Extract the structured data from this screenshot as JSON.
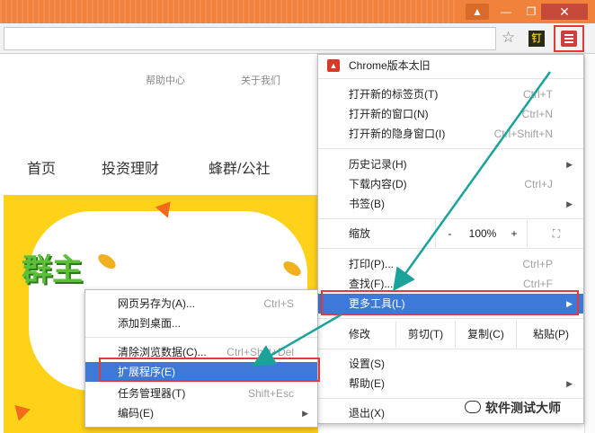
{
  "window": {
    "controls": {
      "user": "▲",
      "minimize": "—",
      "maximize": "❐",
      "close": "✕"
    }
  },
  "toolbar": {
    "omnibox_value": "",
    "star_icon": "star-icon",
    "extension_label": "钉",
    "menu_icon": "hamburger-menu-icon"
  },
  "page": {
    "topnav": [
      "帮助中心",
      "关于我们"
    ],
    "mainnav": [
      "首页",
      "投资理财",
      "蜂群/公社"
    ],
    "banner_text": "群主"
  },
  "menu": {
    "update": "Chrome版本太旧",
    "new_tab": "打开新的标签页(T)",
    "new_tab_sc": "Ctrl+T",
    "new_window": "打开新的窗口(N)",
    "new_window_sc": "Ctrl+N",
    "incognito": "打开新的隐身窗口(I)",
    "incognito_sc": "Ctrl+Shift+N",
    "history": "历史记录(H)",
    "downloads": "下载内容(D)",
    "downloads_sc": "Ctrl+J",
    "bookmarks": "书签(B)",
    "zoom_label": "缩放",
    "zoom_minus": "-",
    "zoom_value": "100%",
    "zoom_plus": "+",
    "fullscreen": "⛶",
    "print": "打印(P)...",
    "print_sc": "Ctrl+P",
    "find": "查找(F)...",
    "find_sc": "Ctrl+F",
    "more_tools": "更多工具(L)",
    "edit_label": "修改",
    "cut": "剪切(T)",
    "copy": "复制(C)",
    "paste": "粘贴(P)",
    "settings": "设置(S)",
    "help": "帮助(E)",
    "exit": "退出(X)",
    "arrow": "▶"
  },
  "submenu": {
    "save_page": "网页另存为(A)...",
    "save_page_sc": "Ctrl+S",
    "add_desktop": "添加到桌面...",
    "clear_data": "清除浏览数据(C)...",
    "clear_data_sc": "Ctrl+Shift+Del",
    "extensions": "扩展程序(E)",
    "task_manager": "任务管理器(T)",
    "task_manager_sc": "Shift+Esc",
    "encoding": "编码(E)"
  },
  "watermark": "软件测试大师",
  "colors": {
    "titlebar": "#f0823c",
    "highlight": "#3d7ad8",
    "annotation_red": "#e23a3a",
    "annotation_arrow": "#1aa39a",
    "banner_yellow": "#ffd21a"
  }
}
